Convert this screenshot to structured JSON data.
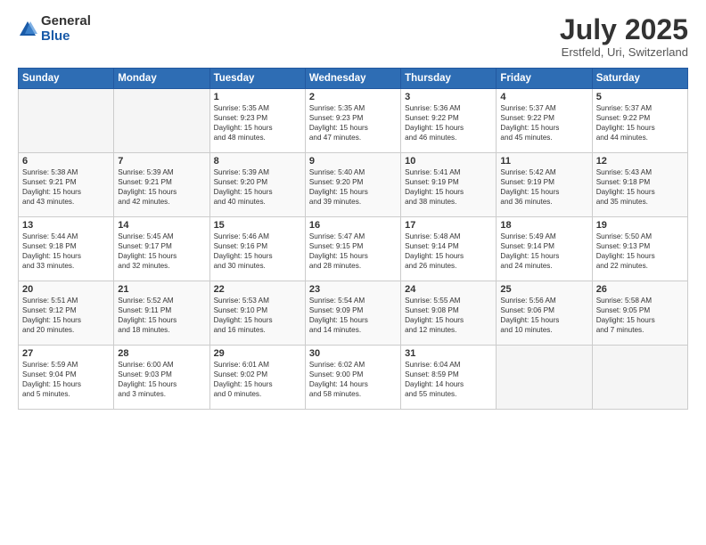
{
  "logo": {
    "general": "General",
    "blue": "Blue"
  },
  "title": "July 2025",
  "location": "Erstfeld, Uri, Switzerland",
  "headers": [
    "Sunday",
    "Monday",
    "Tuesday",
    "Wednesday",
    "Thursday",
    "Friday",
    "Saturday"
  ],
  "weeks": [
    [
      {
        "day": "",
        "sunrise": "",
        "sunset": "",
        "daylight": ""
      },
      {
        "day": "",
        "sunrise": "",
        "sunset": "",
        "daylight": ""
      },
      {
        "day": "1",
        "sunrise": "Sunrise: 5:35 AM",
        "sunset": "Sunset: 9:23 PM",
        "daylight": "Daylight: 15 hours and 48 minutes."
      },
      {
        "day": "2",
        "sunrise": "Sunrise: 5:35 AM",
        "sunset": "Sunset: 9:23 PM",
        "daylight": "Daylight: 15 hours and 47 minutes."
      },
      {
        "day": "3",
        "sunrise": "Sunrise: 5:36 AM",
        "sunset": "Sunset: 9:22 PM",
        "daylight": "Daylight: 15 hours and 46 minutes."
      },
      {
        "day": "4",
        "sunrise": "Sunrise: 5:37 AM",
        "sunset": "Sunset: 9:22 PM",
        "daylight": "Daylight: 15 hours and 45 minutes."
      },
      {
        "day": "5",
        "sunrise": "Sunrise: 5:37 AM",
        "sunset": "Sunset: 9:22 PM",
        "daylight": "Daylight: 15 hours and 44 minutes."
      }
    ],
    [
      {
        "day": "6",
        "sunrise": "Sunrise: 5:38 AM",
        "sunset": "Sunset: 9:21 PM",
        "daylight": "Daylight: 15 hours and 43 minutes."
      },
      {
        "day": "7",
        "sunrise": "Sunrise: 5:39 AM",
        "sunset": "Sunset: 9:21 PM",
        "daylight": "Daylight: 15 hours and 42 minutes."
      },
      {
        "day": "8",
        "sunrise": "Sunrise: 5:39 AM",
        "sunset": "Sunset: 9:20 PM",
        "daylight": "Daylight: 15 hours and 40 minutes."
      },
      {
        "day": "9",
        "sunrise": "Sunrise: 5:40 AM",
        "sunset": "Sunset: 9:20 PM",
        "daylight": "Daylight: 15 hours and 39 minutes."
      },
      {
        "day": "10",
        "sunrise": "Sunrise: 5:41 AM",
        "sunset": "Sunset: 9:19 PM",
        "daylight": "Daylight: 15 hours and 38 minutes."
      },
      {
        "day": "11",
        "sunrise": "Sunrise: 5:42 AM",
        "sunset": "Sunset: 9:19 PM",
        "daylight": "Daylight: 15 hours and 36 minutes."
      },
      {
        "day": "12",
        "sunrise": "Sunrise: 5:43 AM",
        "sunset": "Sunset: 9:18 PM",
        "daylight": "Daylight: 15 hours and 35 minutes."
      }
    ],
    [
      {
        "day": "13",
        "sunrise": "Sunrise: 5:44 AM",
        "sunset": "Sunset: 9:18 PM",
        "daylight": "Daylight: 15 hours and 33 minutes."
      },
      {
        "day": "14",
        "sunrise": "Sunrise: 5:45 AM",
        "sunset": "Sunset: 9:17 PM",
        "daylight": "Daylight: 15 hours and 32 minutes."
      },
      {
        "day": "15",
        "sunrise": "Sunrise: 5:46 AM",
        "sunset": "Sunset: 9:16 PM",
        "daylight": "Daylight: 15 hours and 30 minutes."
      },
      {
        "day": "16",
        "sunrise": "Sunrise: 5:47 AM",
        "sunset": "Sunset: 9:15 PM",
        "daylight": "Daylight: 15 hours and 28 minutes."
      },
      {
        "day": "17",
        "sunrise": "Sunrise: 5:48 AM",
        "sunset": "Sunset: 9:14 PM",
        "daylight": "Daylight: 15 hours and 26 minutes."
      },
      {
        "day": "18",
        "sunrise": "Sunrise: 5:49 AM",
        "sunset": "Sunset: 9:14 PM",
        "daylight": "Daylight: 15 hours and 24 minutes."
      },
      {
        "day": "19",
        "sunrise": "Sunrise: 5:50 AM",
        "sunset": "Sunset: 9:13 PM",
        "daylight": "Daylight: 15 hours and 22 minutes."
      }
    ],
    [
      {
        "day": "20",
        "sunrise": "Sunrise: 5:51 AM",
        "sunset": "Sunset: 9:12 PM",
        "daylight": "Daylight: 15 hours and 20 minutes."
      },
      {
        "day": "21",
        "sunrise": "Sunrise: 5:52 AM",
        "sunset": "Sunset: 9:11 PM",
        "daylight": "Daylight: 15 hours and 18 minutes."
      },
      {
        "day": "22",
        "sunrise": "Sunrise: 5:53 AM",
        "sunset": "Sunset: 9:10 PM",
        "daylight": "Daylight: 15 hours and 16 minutes."
      },
      {
        "day": "23",
        "sunrise": "Sunrise: 5:54 AM",
        "sunset": "Sunset: 9:09 PM",
        "daylight": "Daylight: 15 hours and 14 minutes."
      },
      {
        "day": "24",
        "sunrise": "Sunrise: 5:55 AM",
        "sunset": "Sunset: 9:08 PM",
        "daylight": "Daylight: 15 hours and 12 minutes."
      },
      {
        "day": "25",
        "sunrise": "Sunrise: 5:56 AM",
        "sunset": "Sunset: 9:06 PM",
        "daylight": "Daylight: 15 hours and 10 minutes."
      },
      {
        "day": "26",
        "sunrise": "Sunrise: 5:58 AM",
        "sunset": "Sunset: 9:05 PM",
        "daylight": "Daylight: 15 hours and 7 minutes."
      }
    ],
    [
      {
        "day": "27",
        "sunrise": "Sunrise: 5:59 AM",
        "sunset": "Sunset: 9:04 PM",
        "daylight": "Daylight: 15 hours and 5 minutes."
      },
      {
        "day": "28",
        "sunrise": "Sunrise: 6:00 AM",
        "sunset": "Sunset: 9:03 PM",
        "daylight": "Daylight: 15 hours and 3 minutes."
      },
      {
        "day": "29",
        "sunrise": "Sunrise: 6:01 AM",
        "sunset": "Sunset: 9:02 PM",
        "daylight": "Daylight: 15 hours and 0 minutes."
      },
      {
        "day": "30",
        "sunrise": "Sunrise: 6:02 AM",
        "sunset": "Sunset: 9:00 PM",
        "daylight": "Daylight: 14 hours and 58 minutes."
      },
      {
        "day": "31",
        "sunrise": "Sunrise: 6:04 AM",
        "sunset": "Sunset: 8:59 PM",
        "daylight": "Daylight: 14 hours and 55 minutes."
      },
      {
        "day": "",
        "sunrise": "",
        "sunset": "",
        "daylight": ""
      },
      {
        "day": "",
        "sunrise": "",
        "sunset": "",
        "daylight": ""
      }
    ]
  ]
}
